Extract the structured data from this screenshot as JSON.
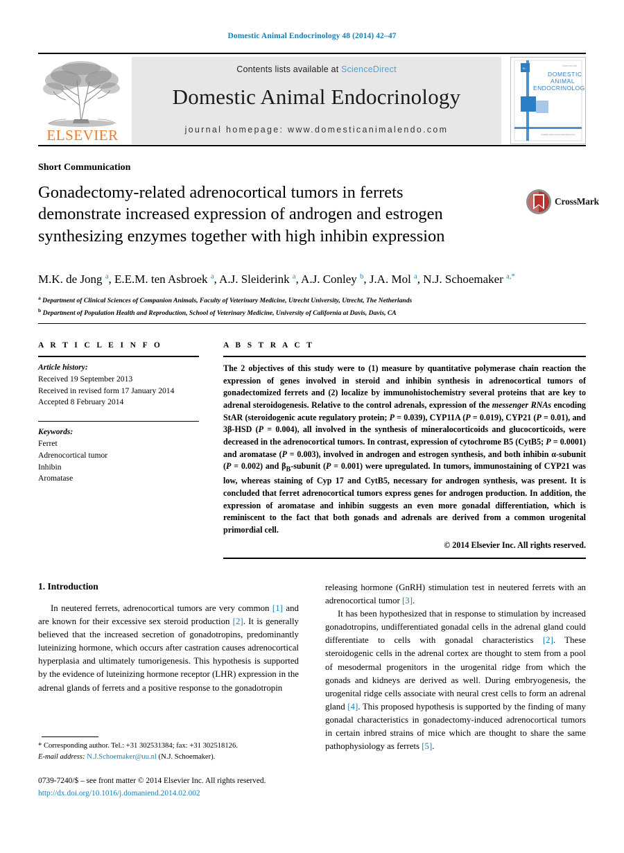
{
  "running_head": "Domestic Animal Endocrinology 48 (2014) 42–47",
  "header": {
    "publisher_name": "ELSEVIER",
    "contents_prefix": "Contents lists available at ",
    "sciencedirect": "ScienceDirect",
    "journal_title": "Domestic Animal Endocrinology",
    "homepage": "journal homepage: www.domesticanimalendo.com",
    "cover": {
      "line1": "DOMESTIC",
      "line2": "ANIMAL",
      "line3": "ENDOCRINOLOGY",
      "corner_text": "ISSN 0739-7240",
      "bottom_text": "Available online at www.sciencedirect.com"
    },
    "accent_blue": "#1a7fb5",
    "elsevier_orange": "#ee7c26",
    "banner_bg": "#e7e7e7"
  },
  "article": {
    "type": "Short Communication",
    "title": "Gonadectomy-related adrenocortical tumors in ferrets demonstrate increased expression of androgen and estrogen synthesizing enzymes together with high inhibin expression",
    "crossmark_label": "CrossMark",
    "authors_html": "M.K. de Jong <sup>a</sup>, E.E.M. ten Asbroek <sup>a</sup>, A.J. Sleiderink <sup>a</sup>, A.J. Conley <sup>b</sup>, J.A. Mol <sup>a</sup>, N.J. Schoemaker <sup>a,</sup><sup>*</sup>",
    "affiliation_a": "Department of Clinical Sciences of Companion Animals, Faculty of Veterinary Medicine, Utrecht University, Utrecht, The Netherlands",
    "affiliation_b": "Department of Population Health and Reproduction, School of Veterinary Medicine, University of California at Davis, Davis, CA",
    "affiliation_a_mark": "a",
    "affiliation_b_mark": "b"
  },
  "article_info": {
    "label": "A R T I C L E  I N F O",
    "history_head": "Article history:",
    "history": [
      "Received 19 September 2013",
      "Received in revised form 17 January 2014",
      "Accepted 8 February 2014"
    ],
    "keywords_head": "Keywords:",
    "keywords": [
      "Ferret",
      "Adrenocortical tumor",
      "Inhibin",
      "Aromatase"
    ]
  },
  "abstract": {
    "label": "A B S T R A C T",
    "html": "The 2 objectives of this study were to (1) measure by quantitative polymerase chain reaction the expression of genes involved in steroid and inhibin synthesis in adrenocortical tumors of gonadectomized ferrets and (2) localize by immunohistochemistry several proteins that are key to adrenal steroidogenesis. Relative to the control adrenals, expression of the <i>messenger RNAs</i> encoding StAR (steroidogenic acute regulatory protein; <i>P</i> = 0.039), CYP11A (<i>P</i> = 0.019), CYP21 (<i>P</i> = 0.01), and 3&beta;-HSD (<i>P</i> = 0.004), all involved in the synthesis of mineralocorticoids and glucocorticoids, were decreased in the adrenocortical tumors. In contrast, expression of cytochrome B5 (CytB5; <i>P</i> = 0.0001) and aromatase (<i>P</i> = 0.003), involved in androgen and estrogen synthesis, and both inhibin &alpha;-subunit (<i>P</i> = 0.002) and &beta;<sub>B</sub>-subunit (<i>P</i> = 0.001) were upregulated. In tumors, immunostaining of CYP21 was low, whereas staining of Cyp 17 and CytB5, necessary for androgen synthesis, was present. It is concluded that ferret adrenocortical tumors express genes for androgen production. In addition, the expression of aromatase and inhibin suggests an even more gonadal differentiation, which is reminiscent to the fact that both gonads and adrenals are derived from a common urogenital primordial cell.",
    "copyright": "© 2014 Elsevier Inc. All rights reserved."
  },
  "body": {
    "section_number_title": "1. Introduction",
    "left_paragraph_html": "In neutered ferrets, adrenocortical tumors are very common <span class=\"ref\">[1]</span> and are known for their excessive sex steroid production <span class=\"ref\">[2]</span>. It is generally believed that the increased secretion of gonadotropins, predominantly luteinizing hormone, which occurs after castration causes adrenocortical hyperplasia and ultimately tumorigenesis. This hypothesis is supported by the evidence of luteinizing hormone receptor (LHR) expression in the adrenal glands of ferrets and a positive response to the gonadotropin",
    "right_paragraph1_html": "releasing hormone (GnRH) stimulation test in neutered ferrets with an adrenocortical tumor <span class=\"ref\">[3]</span>.",
    "right_paragraph2_html": "It has been hypothesized that in response to stimulation by increased gonadotropins, undifferentiated gonadal cells in the adrenal gland could differentiate to cells with gonadal characteristics <span class=\"ref\">[2]</span>. These steroidogenic cells in the adrenal cortex are thought to stem from a pool of mesodermal progenitors in the urogenital ridge from which the gonads and kidneys are derived as well. During embryogenesis, the urogenital ridge cells associate with neural crest cells to form an adrenal gland <span class=\"ref\">[4]</span>. This proposed hypothesis is supported by the finding of many gonadal characteristics in gonadectomy-induced adrenocortical tumors in certain inbred strains of mice which are thought to share the same pathophysiology as ferrets <span class=\"ref\">[5]</span>."
  },
  "footnote": {
    "html": "* Corresponding author. Tel.: +31 302531384; fax: +31 302518126.<br><span class=\"em-label\">E-mail address:</span> <span class=\"mail-link\">N.J.Schoemaker@uu.nl</span> (N.J. Schoemaker).",
    "email": "N.J.Schoemaker@uu.nl"
  },
  "footer": {
    "issn_line": "0739-7240/$ – see front matter © 2014 Elsevier Inc. All rights reserved.",
    "doi": "http://dx.doi.org/10.1016/j.domaniend.2014.02.002"
  }
}
